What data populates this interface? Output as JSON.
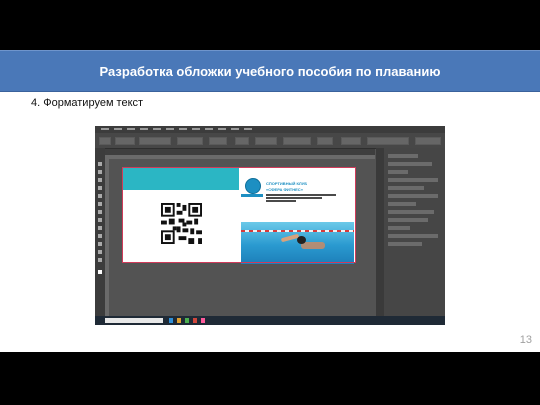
{
  "slide": {
    "title": "Разработка обложки учебного пособия по плаванию",
    "subheading": "4. Форматируем текст",
    "page_number": "13"
  },
  "screenshot": {
    "app": "Adobe InDesign",
    "cover": {
      "club_line1": "СПОРТИВНЫЙ КЛУБ",
      "club_line2": "«СФЕРА ФИТНЕС»"
    }
  },
  "colors": {
    "title_bar": "#4a78b8",
    "teal": "#2bb6c4",
    "brand_blue": "#1d8fc2"
  },
  "icons": [
    "qr-code-icon",
    "search-icon",
    "logo-icon"
  ]
}
